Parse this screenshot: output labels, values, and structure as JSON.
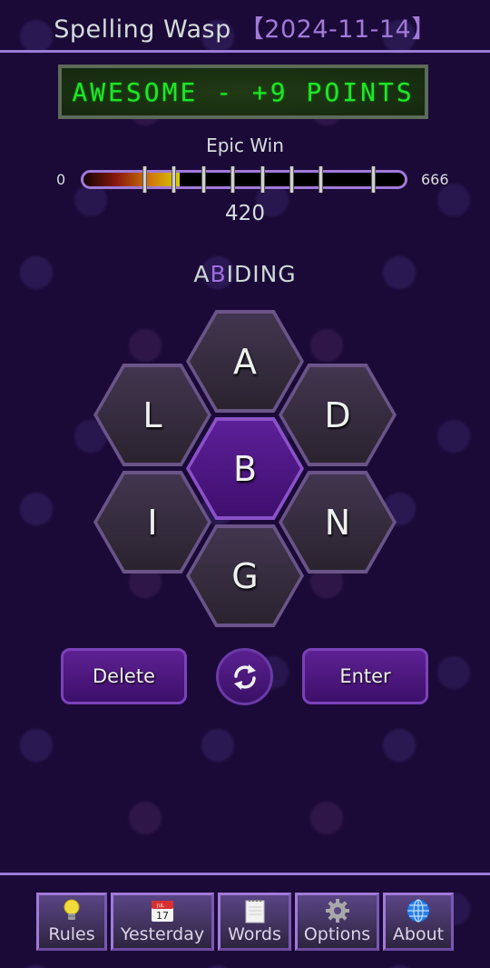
{
  "header": {
    "title": "Spelling Wasp",
    "date": "【2024-11-14】"
  },
  "message": "AWESOME - +9 POINTS",
  "progress": {
    "rank": "Epic Win",
    "min": "0",
    "max": "666",
    "score": "420",
    "fill_fraction": 0.3,
    "tick_fractions": [
      0.105,
      0.205,
      0.305,
      0.405,
      0.505,
      0.605,
      0.705,
      1.0
    ]
  },
  "current_word": {
    "before": "A",
    "center": "B",
    "after": "IDING"
  },
  "hive": {
    "center_letter": "B",
    "letters": [
      "A",
      "L",
      "D",
      "B",
      "I",
      "N",
      "G"
    ]
  },
  "controls": {
    "delete_label": "Delete",
    "enter_label": "Enter",
    "shuffle_icon": "refresh-icon"
  },
  "nav": [
    {
      "label": "Rules",
      "icon": "lightbulb-icon"
    },
    {
      "label": "Yesterday",
      "icon": "calendar-icon",
      "calendar_month": "JUL",
      "calendar_day": "17"
    },
    {
      "label": "Words",
      "icon": "notepad-icon"
    },
    {
      "label": "Options",
      "icon": "gear-icon"
    },
    {
      "label": "About",
      "icon": "globe-icon"
    }
  ],
  "colors": {
    "background": "#1b0a38",
    "accent": "#a07ad8",
    "lcd_text": "#1ee628",
    "center_hex": "#5c1f98",
    "outer_hex": "#3a2f44"
  }
}
